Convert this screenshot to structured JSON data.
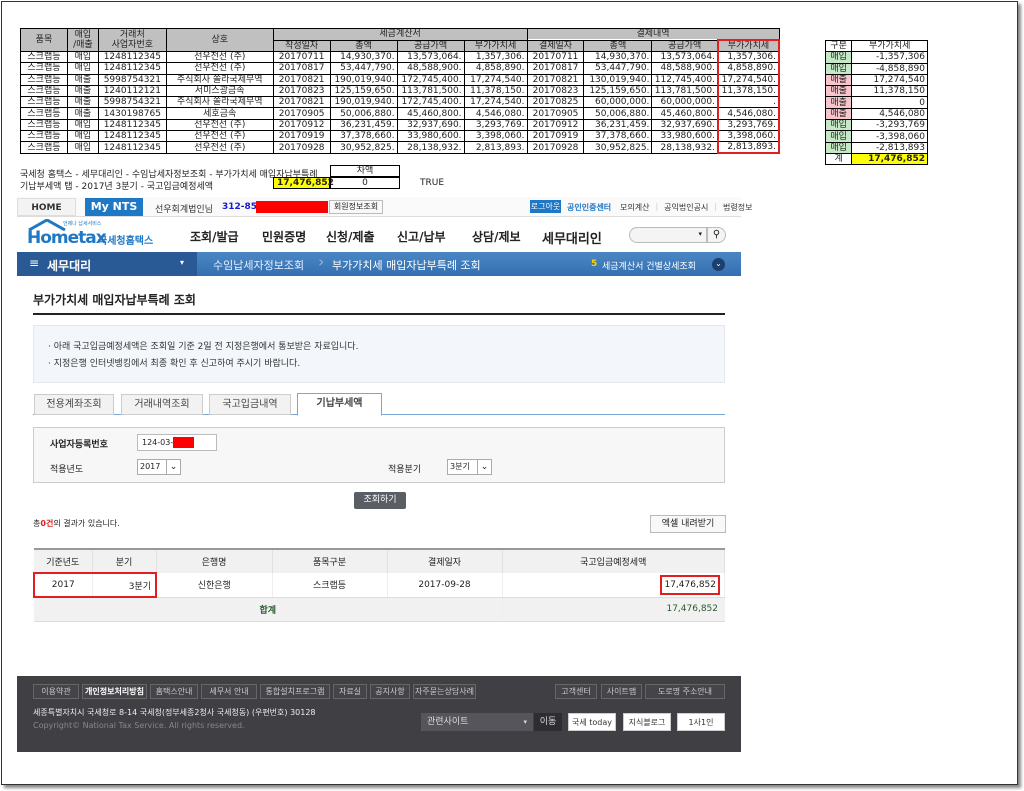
{
  "sheet": {
    "headers": {
      "item": "품목",
      "type": "매입\n/매출",
      "bizno": "거래처\n사업자번호",
      "name": "상호",
      "invoice_group": "세금계산서",
      "payment_group": "결제내역",
      "issue_date": "작성일자",
      "total": "총액",
      "supply": "공급가액",
      "vat": "부가가치세",
      "pay_date": "결제일자",
      "pay_total": "총액",
      "pay_supply": "공급가액",
      "pay_vat": "부가가치세"
    },
    "rows": [
      [
        "스크랩등",
        "매입",
        "1248112345",
        "선우전선 (주)",
        "20170711",
        "14,930,370.",
        "13,573,064.",
        "1,357,306.",
        "20170711",
        "14,930,370.",
        "13,573,064.",
        "1,357,306."
      ],
      [
        "스크랩등",
        "매입",
        "1248112345",
        "선우전선 (주)",
        "20170817",
        "53,447,790.",
        "48,588,900.",
        "4,858,890.",
        "20170817",
        "53,447,790.",
        "48,588,900.",
        "4,858,890."
      ],
      [
        "스크랩등",
        "매출",
        "5998754321",
        "주식회사 쏠라국제무역",
        "20170821",
        "190,019,940.",
        "172,745,400.",
        "17,274,540.",
        "20170821",
        "130,019,940.",
        "112,745,400.",
        "17,274,540."
      ],
      [
        "스크랩등",
        "매출",
        "1240112121",
        "서미스광금속",
        "20170823",
        "125,159,650.",
        "113,781,500.",
        "11,378,150.",
        "20170823",
        "125,159,650.",
        "113,781,500.",
        "11,378,150."
      ],
      [
        "스크랩등",
        "매출",
        "5998754321",
        "주식회사 쏠라국제무역",
        "20170821",
        "190,019,940.",
        "172,745,400.",
        "17,274,540.",
        "20170825",
        "60,000,000.",
        "60,000,000.",
        "."
      ],
      [
        "스크랩등",
        "매출",
        "1430198765",
        "세호금속",
        "20170905",
        "50,006,880.",
        "45,460,800.",
        "4,546,080.",
        "20170905",
        "50,006,880.",
        "45,460,800.",
        "4,546,080."
      ],
      [
        "스크랩등",
        "매입",
        "1248112345",
        "선우전선 (주)",
        "20170912",
        "36,231,459.",
        "32,937,690.",
        "3,293,769.",
        "20170912",
        "36,231,459.",
        "32,937,690.",
        "3,293,769."
      ],
      [
        "스크랩등",
        "매입",
        "1248112345",
        "선우전선 (주)",
        "20170919",
        "37,378,660.",
        "33,980,600.",
        "3,398,060.",
        "20170919",
        "37,378,660.",
        "33,980,600.",
        "3,398,060."
      ],
      [
        "스크랩등",
        "매입",
        "1248112345",
        "선우전선 (주)",
        "20170928",
        "30,952,825.",
        "28,138,932.",
        "2,813,893.",
        "20170928",
        "30,952,825.",
        "28,138,932.",
        "2,813,893."
      ]
    ],
    "note_line1": "국세청 홈택스 - 세무대리인 - 수임납세자정보조회 - 부가가치세 매입자납부특례",
    "note_line2": "기납부세액 탭 - 2017년 3분기 - 국고입금예정세액",
    "diff_label": "차액",
    "amount": "17,476,852",
    "diff": "0",
    "check": "TRUE"
  },
  "mini": {
    "headers": [
      "구분",
      "부가가치세"
    ],
    "rows": [
      [
        "매입",
        "-1,357,306",
        "buy"
      ],
      [
        "매입",
        "-4,858,890",
        "buy"
      ],
      [
        "매출",
        "17,274,540",
        "sell"
      ],
      [
        "매출",
        "11,378,150",
        "sell"
      ],
      [
        "매출",
        "0",
        "sell"
      ],
      [
        "매출",
        "4,546,080",
        "sell"
      ],
      [
        "매입",
        "-3,293,769",
        "buy"
      ],
      [
        "매입",
        "-3,398,060",
        "buy"
      ],
      [
        "매입",
        "-2,813,893",
        "buy"
      ]
    ],
    "total_label": "계",
    "total": "17,476,852"
  },
  "topbar": {
    "home": "HOME",
    "mynts": "My NTS",
    "user": "선우회계법인님",
    "bizno": "312-85-",
    "member_info": "회원정보조회",
    "logout": "로그아웃",
    "cert": "공인인증센터",
    "links": [
      "모의계산",
      "공익법인공시",
      "법령정보"
    ]
  },
  "logo": {
    "brand": "Hometax",
    "subtitle": "국세청홈택스",
    "tagline": "언제나 납세서비스"
  },
  "menu": [
    "조회/발급",
    "민원증명",
    "신청/제출",
    "신고/납부",
    "상담/제보",
    "세무대리인"
  ],
  "nav": {
    "section": "세무대리",
    "crumb1": "수임납세자정보조회",
    "crumb2": "부가가치세 매입자납부특례 조회",
    "quick_num": "5",
    "quick": "세금계산서 건별상세조회"
  },
  "page": {
    "title": "부가가치세 매입자납부특례 조회",
    "notices": [
      "아래 국고입금예정세액은 조회일 기준 2일 전 지정은행에서 통보받은 자료입니다.",
      "지정은행 인터넷뱅킹에서 최종 확인 후 신고하여 주시기 바랍니다."
    ],
    "tabs": [
      "전용계좌조회",
      "거래내역조회",
      "국고입금내역",
      "기납부세액"
    ],
    "form": {
      "bizno_label": "사업자등록번호",
      "bizno_value": "124-03-",
      "year_label": "적용년도",
      "year_value": "2017",
      "quarter_label": "적용분기",
      "quarter_value": "3분기"
    },
    "search_btn": "조회하기",
    "count_pre": "총",
    "count": "0건",
    "count_post": "의 결과가 있습니다.",
    "excel_btn": "엑셀 내려받기",
    "table": {
      "headers": [
        "기준년도",
        "분기",
        "은행명",
        "품목구분",
        "결제일자",
        "국고입금예정세액"
      ],
      "row": [
        "2017",
        "3분기",
        "신한은행",
        "스크랩등",
        "2017-09-28",
        "17,476,852"
      ],
      "total_label": "합계",
      "total": "17,476,852"
    }
  },
  "footer": {
    "links": [
      "이용약관",
      "개인정보처리방침",
      "홈택스안내",
      "세무서 안내",
      "통합설치프로그램",
      "자료실",
      "공지사항",
      "자주묻는상담사례",
      "고객센터",
      "사이트맵",
      "도로명 주소안내"
    ],
    "address": "세종특별자치시 국세청로 8-14 국세청(정부세종2청사 국세청동) (우편번호) 30128",
    "copyright": "Copyright© National Tax Service. All rights reserved.",
    "related": "관련사이트",
    "go": "이동",
    "banners": [
      "국세 today",
      "지식블로그",
      "1사1인"
    ]
  },
  "colors": {
    "blue": "#1f78c6",
    "nav": "#3f78b8",
    "highlight": "#ffff00",
    "red": "#e02020"
  }
}
